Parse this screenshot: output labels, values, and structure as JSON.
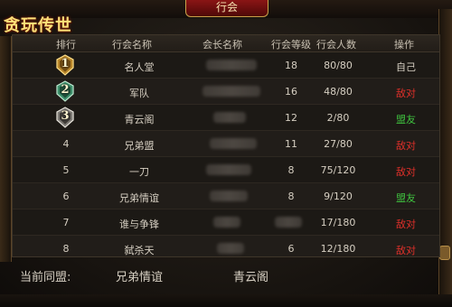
{
  "window": {
    "title": "行会"
  },
  "logo": {
    "text": "贪玩传世"
  },
  "table": {
    "headers": {
      "rank": "排行",
      "guild_name": "行会名称",
      "leader_name": "会长名称",
      "guild_level": "行会等级",
      "member_count": "行会人数",
      "action": "操作"
    },
    "rows": [
      {
        "rank": "1",
        "medal": "gold",
        "name": "名人堂",
        "level": "18",
        "members": "80/80",
        "action": "自己",
        "action_type": "self"
      },
      {
        "rank": "2",
        "medal": "green",
        "name": "军队",
        "level": "16",
        "members": "48/80",
        "action": "敌对",
        "action_type": "enemy"
      },
      {
        "rank": "3",
        "medal": "silver",
        "name": "青云阁",
        "level": "12",
        "members": "2/80",
        "action": "盟友",
        "action_type": "ally"
      },
      {
        "rank": "4",
        "name": "兄弟盟",
        "level": "11",
        "members": "27/80",
        "action": "敌对",
        "action_type": "enemy"
      },
      {
        "rank": "5",
        "name": "一刀",
        "level": "8",
        "members": "75/120",
        "action": "敌对",
        "action_type": "enemy"
      },
      {
        "rank": "6",
        "name": "兄弟情谊",
        "level": "8",
        "members": "9/120",
        "action": "盟友",
        "action_type": "ally"
      },
      {
        "rank": "7",
        "name": "谁与争锋",
        "level": "",
        "members": "17/180",
        "action": "敌对",
        "action_type": "enemy"
      },
      {
        "rank": "8",
        "name": "弑杀天",
        "level": "6",
        "members": "12/180",
        "action": "敌对",
        "action_type": "enemy"
      }
    ]
  },
  "footer": {
    "label": "当前同盟:",
    "alliances": [
      "兄弟情谊",
      "青云阁"
    ]
  },
  "colors": {
    "enemy": "#e0302a",
    "ally": "#3fc23f",
    "title_plate": "#8a1515",
    "gold_trim": "#c9a24a"
  },
  "icons": {
    "medal_1": "gold-rank-medal-icon",
    "medal_2": "green-rank-medal-icon",
    "medal_3": "silver-rank-medal-icon"
  }
}
